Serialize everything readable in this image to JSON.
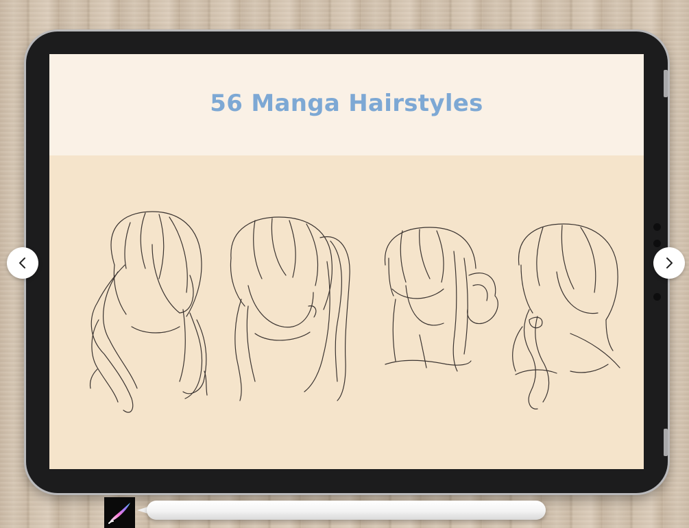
{
  "slide": {
    "title": "56 Manga Hairstyles"
  },
  "navigation": {
    "prev_icon": "chevron-left-icon",
    "next_icon": "chevron-right-icon"
  },
  "app_icon": "procreate-brush-icon",
  "colors": {
    "title": "#7da8d4",
    "banner_bg": "#faf1e6",
    "canvas_bg": "#f5e4cb",
    "tablet_bezel": "#1c1c1d"
  }
}
